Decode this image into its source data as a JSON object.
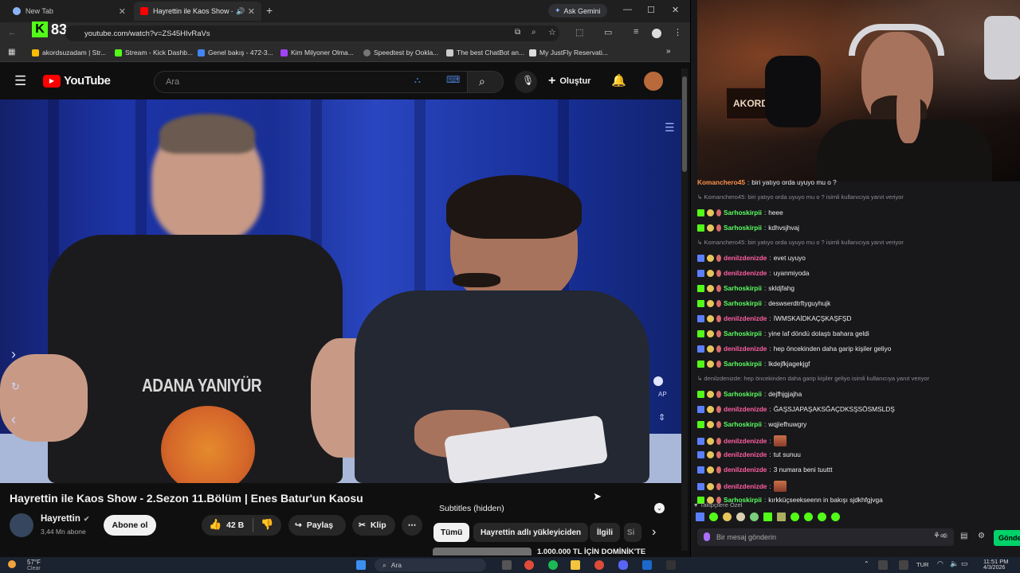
{
  "browser": {
    "tabs": [
      {
        "label": "New Tab",
        "active": false
      },
      {
        "label": "Hayrettin ile Kaos Show - 2",
        "active": true
      }
    ],
    "gemini_label": "Ask Gemini",
    "url": "youtube.com/watch?v=ZS45HIvRaVs",
    "overlay_counter": "83",
    "bookmarks": [
      "akordsuzadam | Str...",
      "Stream - Kick Dashb...",
      "Genel bakış - 472-3...",
      "Kim Milyoner Olma...",
      "Speedtest by Ookla...",
      "The best ChatBot an...",
      "My JustFly Reservati..."
    ]
  },
  "youtube": {
    "logo": "YouTube",
    "search_placeholder": "Ara",
    "create_label": "Oluştur",
    "video": {
      "shirt_text": "ADANA YANIYÜR",
      "ap_label": "AP"
    },
    "title": "Hayrettin ile Kaos Show - 2.Sezon 11.Bölüm | Enes Batur'un Kaosu",
    "channel": {
      "name": "Hayrettin",
      "subs": "3,44 Mn abone",
      "subscribe_label": "Abone ol"
    },
    "actions": {
      "likes": "42 B",
      "share": "Paylaş",
      "clip": "Klip"
    },
    "subtitles_label": "Subtitles (hidden)",
    "chips": [
      "Tümü",
      "Hayrettin adlı yükleyiciden",
      "İlgili",
      "Si"
    ],
    "next_video_title": "1.000.000 TL İÇİN DOMİNİK'TE"
  },
  "stream": {
    "cam_sign": "AKORDSZ",
    "chat": [
      {
        "type": "msg",
        "user": "Komanchero45",
        "text": "biri yatıyo orda uyuyo mu o ?",
        "color": "#ff9147"
      },
      {
        "type": "reply",
        "text": "Komanchero45: biri yatıyo orda uyuyo mu o ? isimli kullanıcıya yanıt veriyor"
      },
      {
        "type": "msg",
        "user": "Sarhoskirpii",
        "text": "heee",
        "color": "#5bff60"
      },
      {
        "type": "msg",
        "user": "Sarhoskirpii",
        "text": "kdhvsjhvaj",
        "color": "#5bff60"
      },
      {
        "type": "reply",
        "text": "Komanchero45: biri yatıyo orda uyuyo mu o ? isimli kullanıcıya yanıt veriyor"
      },
      {
        "type": "msg",
        "user": "denilzdenizde",
        "text": "evet uyuyo",
        "color": "#ff5fa2"
      },
      {
        "type": "msg",
        "user": "denilzdenizde",
        "text": "uyanmiyoda",
        "color": "#ff5fa2"
      },
      {
        "type": "msg",
        "user": "Sarhoskirpii",
        "text": "skldjfahg",
        "color": "#5bff60"
      },
      {
        "type": "msg",
        "user": "Sarhoskirpii",
        "text": "deswserdtrftyguyhujk",
        "color": "#5bff60"
      },
      {
        "type": "msg",
        "user": "denilzdenizde",
        "text": "İWMSKAİDKAÇŞKAŞFŞD",
        "color": "#ff5fa2"
      },
      {
        "type": "msg",
        "user": "Sarhoskirpii",
        "text": "yine laf döndü dolaştı bahara geldi",
        "color": "#5bff60"
      },
      {
        "type": "msg",
        "user": "denilzdenizde",
        "text": "hep öncekinden daha garip kişiler geliyo",
        "color": "#ff5fa2"
      },
      {
        "type": "msg",
        "user": "Sarhoskirpii",
        "text": "lkdejfkjagekjgf",
        "color": "#5bff60"
      },
      {
        "type": "reply",
        "text": "denilzdenizde: hep öncekinden daha garip kişiler geliyo isimli kullanıcıya yanıt veriyor"
      },
      {
        "type": "msg",
        "user": "Sarhoskirpii",
        "text": "dejfhjgjajha",
        "color": "#5bff60"
      },
      {
        "type": "msg",
        "user": "denilzdenizde",
        "text": "ĞAŞSJAPAŞAKSĞAÇDKSŞSÖSMSLDŞ",
        "color": "#ff5fa2"
      },
      {
        "type": "msg",
        "user": "Sarhoskirpii",
        "text": "wqjiefhuwgry",
        "color": "#5bff60"
      },
      {
        "type": "msg",
        "user": "denilzdenizde",
        "text": "",
        "color": "#ff5fa2",
        "emote": true
      },
      {
        "type": "msg",
        "user": "denilzdenizde",
        "text": "tut sunuu",
        "color": "#ff5fa2"
      },
      {
        "type": "msg",
        "user": "denilzdenizde",
        "text": "3 numara beni tuuttt",
        "color": "#ff5fa2"
      },
      {
        "type": "msg",
        "user": "denilzdenizde",
        "text": "",
        "color": "#ff5fa2",
        "emote": true
      },
      {
        "type": "msg",
        "user": "Sarhoskirpii",
        "text": "kırkküçseekseenn in bakışı sjdkhfgjvga",
        "color": "#5bff60"
      }
    ],
    "followers_label": "Takipçilere Özel",
    "input_placeholder": "Bir mesaj gönderin",
    "send_label": "Gönder"
  },
  "taskbar": {
    "weather_temp": "57°F",
    "weather_desc": "Clear",
    "search_label": "Ara",
    "lang": "TUR",
    "time": "11:51 PM",
    "date": "4/3/2026"
  },
  "colors": {
    "yt_red": "#ff0000",
    "kick_green": "#53fc18",
    "send_green": "#00d26a"
  }
}
